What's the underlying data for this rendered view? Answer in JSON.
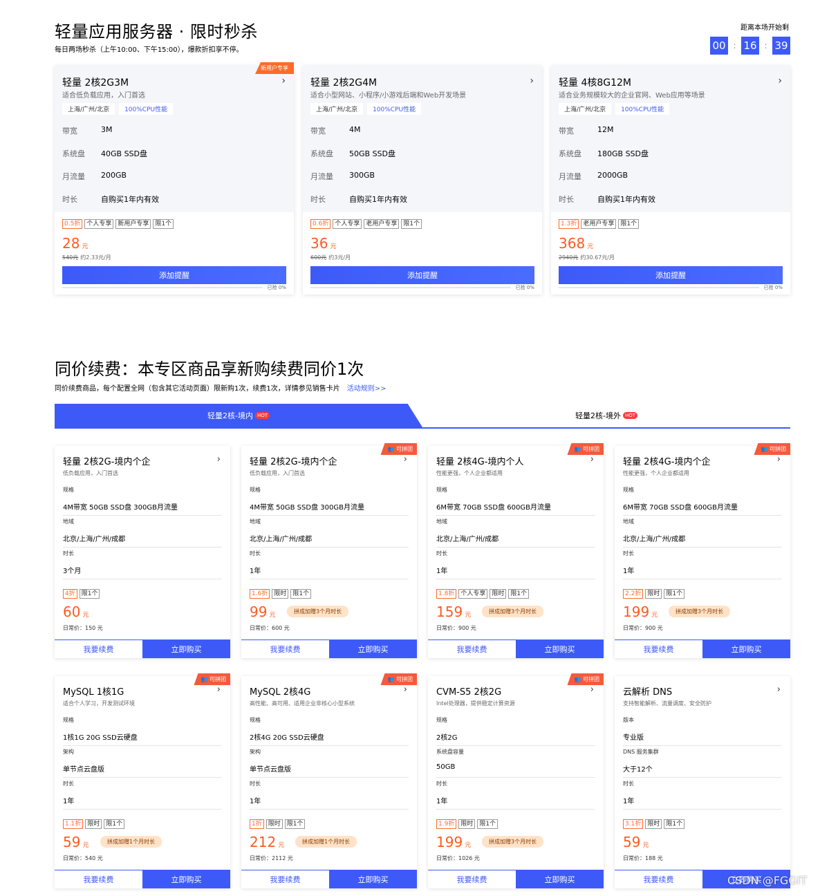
{
  "flash": {
    "title": "轻量应用服务器 · 限时秒杀",
    "subtitle": "每日两场秒杀（上午10:00、下午15:00），爆款折扣享不停。",
    "countdown_label": "距离本场开始剩",
    "countdown": {
      "h": "00",
      "m": "16",
      "s": "39",
      "sep": ":"
    },
    "spec_labels": {
      "bw": "带宽",
      "disk": "系统盘",
      "traffic": "月流量",
      "dur": "时长"
    },
    "button_label": "添加提醒",
    "cards": [
      {
        "name": "轻量 2核2G3M",
        "ribbon": "新用户专享",
        "desc": "适合低负载应用，入门首选",
        "region": "上海/广州/北京",
        "cpu": "100%CPU性能",
        "bw": "3M",
        "disk": "40GB SSD盘",
        "traffic": "200GB",
        "dur": "自购买1年内有效",
        "discount": "0.5折",
        "tags": [
          "个人专享",
          "新用户专享",
          "限1个"
        ],
        "price": "28",
        "unit": "元",
        "orig": "540元",
        "monthly": "约2.33元/月",
        "sold_pct": 0,
        "sold": "已抢 0%"
      },
      {
        "name": "轻量 2核2G4M",
        "desc": "适合小型网站、小程序/小游戏后端和Web开发场景",
        "region": "上海/广州/北京",
        "cpu": "100%CPU性能",
        "bw": "4M",
        "disk": "50GB SSD盘",
        "traffic": "300GB",
        "dur": "自购买1年内有效",
        "discount": "0.6折",
        "tags": [
          "个人专享",
          "老用户专享",
          "限1个"
        ],
        "price": "36",
        "unit": "元",
        "orig": "600元",
        "monthly": "约3元/月",
        "sold_pct": 0,
        "sold": "已抢 0%"
      },
      {
        "name": "轻量 4核8G12M",
        "desc": "适合业务规模较大的企业官网、Web应用等场景",
        "region": "上海/广州/北京",
        "cpu": "100%CPU性能",
        "bw": "12M",
        "disk": "180GB SSD盘",
        "traffic": "2000GB",
        "dur": "自购买1年内有效",
        "discount": "1.3折",
        "tags": [
          "老用户专享",
          "限1个"
        ],
        "price": "368",
        "unit": "元",
        "orig": "2940元",
        "monthly": "约30.67元/月",
        "sold_pct": 0,
        "sold": "已抢 0%"
      }
    ]
  },
  "renew": {
    "title": "同价续费：本专区商品享新购续费同价1次",
    "subtitle": "同价续费商品，每个配置全网（包含其它活动页面）限新购1次，续费1次，详情参见销售卡片",
    "rules_link": "活动规则>>",
    "tabs": [
      {
        "label": "轻量2核-境内",
        "hot": "HOT"
      },
      {
        "label": "轻量2核-境外",
        "hot": "HOT"
      }
    ],
    "renew_label": "我要续费",
    "buy_label": "立即购买",
    "group_label": "可拼团",
    "cards": [
      {
        "name": "轻量 2核2G-境内个企",
        "desc": "低负载应用，入门首选",
        "group": false,
        "l1": "规格",
        "v1": "4M带宽 50GB SSD盘 300GB月流量",
        "l2": "地域",
        "v2": "北京/上海/广州/成都",
        "l3": "时长",
        "v3": "3个月",
        "discount": "4折",
        "tags": [
          "限1个"
        ],
        "price": "60",
        "unit": "元",
        "promo": "",
        "daily": "日常价：150 元"
      },
      {
        "name": "轻量 2核2G-境内个企",
        "desc": "低负载应用，入门首选",
        "group": true,
        "l1": "规格",
        "v1": "4M带宽 50GB SSD盘 300GB月流量",
        "l2": "地域",
        "v2": "北京/上海/广州/成都",
        "l3": "时长",
        "v3": "1年",
        "discount": "1.6折",
        "tags": [
          "限时",
          "限1个"
        ],
        "price": "99",
        "unit": "元",
        "promo": "拼成加赠3个月时长",
        "daily": "日常价：600 元"
      },
      {
        "name": "轻量 2核4G-境内个人",
        "desc": "性能更强，个人企业都适用",
        "group": true,
        "l1": "规格",
        "v1": "6M带宽 70GB SSD盘 600GB月流量",
        "l2": "地域",
        "v2": "北京/上海/广州/成都",
        "l3": "时长",
        "v3": "1年",
        "discount": "1.8折",
        "tags": [
          "个人专享",
          "限时",
          "限1个"
        ],
        "price": "159",
        "unit": "元",
        "promo": "拼成加赠3个月时长",
        "daily": "日常价：900 元"
      },
      {
        "name": "轻量 2核4G-境内个企",
        "desc": "性能更强，个人企业都适用",
        "group": true,
        "l1": "规格",
        "v1": "6M带宽 70GB SSD盘 600GB月流量",
        "l2": "地域",
        "v2": "北京/上海/广州/成都",
        "l3": "时长",
        "v3": "1年",
        "discount": "2.2折",
        "tags": [
          "限时",
          "限1个"
        ],
        "price": "199",
        "unit": "元",
        "promo": "拼成加赠3个月时长",
        "daily": "日常价：900 元"
      },
      {
        "name": "MySQL 1核1G",
        "desc": "适合个人学习，开发测试环境",
        "group": true,
        "l1": "规格",
        "v1": "1核1G 20G SSD云硬盘",
        "l2": "架构",
        "v2": "单节点云盘版",
        "l3": "时长",
        "v3": "1年",
        "discount": "1.1折",
        "tags": [
          "限时",
          "限1个"
        ],
        "price": "59",
        "unit": "元",
        "promo": "拼成加赠1个月时长",
        "daily": "日常价：540 元"
      },
      {
        "name": "MySQL 2核4G",
        "desc": "高性能、高可用、适用企业非核心小型系统",
        "group": true,
        "l1": "规格",
        "v1": "2核4G 20G SSD云硬盘",
        "l2": "架构",
        "v2": "单节点云盘版",
        "l3": "时长",
        "v3": "1年",
        "discount": "1折",
        "tags": [
          "限时",
          "限1个"
        ],
        "price": "212",
        "unit": "元",
        "promo": "拼成加赠1个月时长",
        "daily": "日常价：2112 元"
      },
      {
        "name": "CVM-S5 2核2G",
        "desc": "Intel处理器，提供稳定计算资源",
        "group": true,
        "l1": "规格",
        "v1": "2核2G",
        "l2": "系统盘容量",
        "v2": "50GB",
        "l3": "时长",
        "v3": "1年",
        "discount": "1.9折",
        "tags": [
          "限时",
          "限1个"
        ],
        "price": "199",
        "unit": "元",
        "promo": "拼成加赠3个月时长",
        "daily": "日常价：1026 元"
      },
      {
        "name": "云解析 DNS",
        "desc": "支持智能解析、流量调度、安全防护",
        "group": false,
        "l1": "版本",
        "v1": "专业版",
        "l2": "DNS 服务集群",
        "v2": "大于12个",
        "l3": "时长",
        "v3": "1年",
        "discount": "3.1折",
        "tags": [
          "限时",
          "限1个"
        ],
        "price": "59",
        "unit": "元",
        "promo": "",
        "daily": "日常价：188 元"
      }
    ]
  },
  "watermark": "CSDN @FGGIT"
}
